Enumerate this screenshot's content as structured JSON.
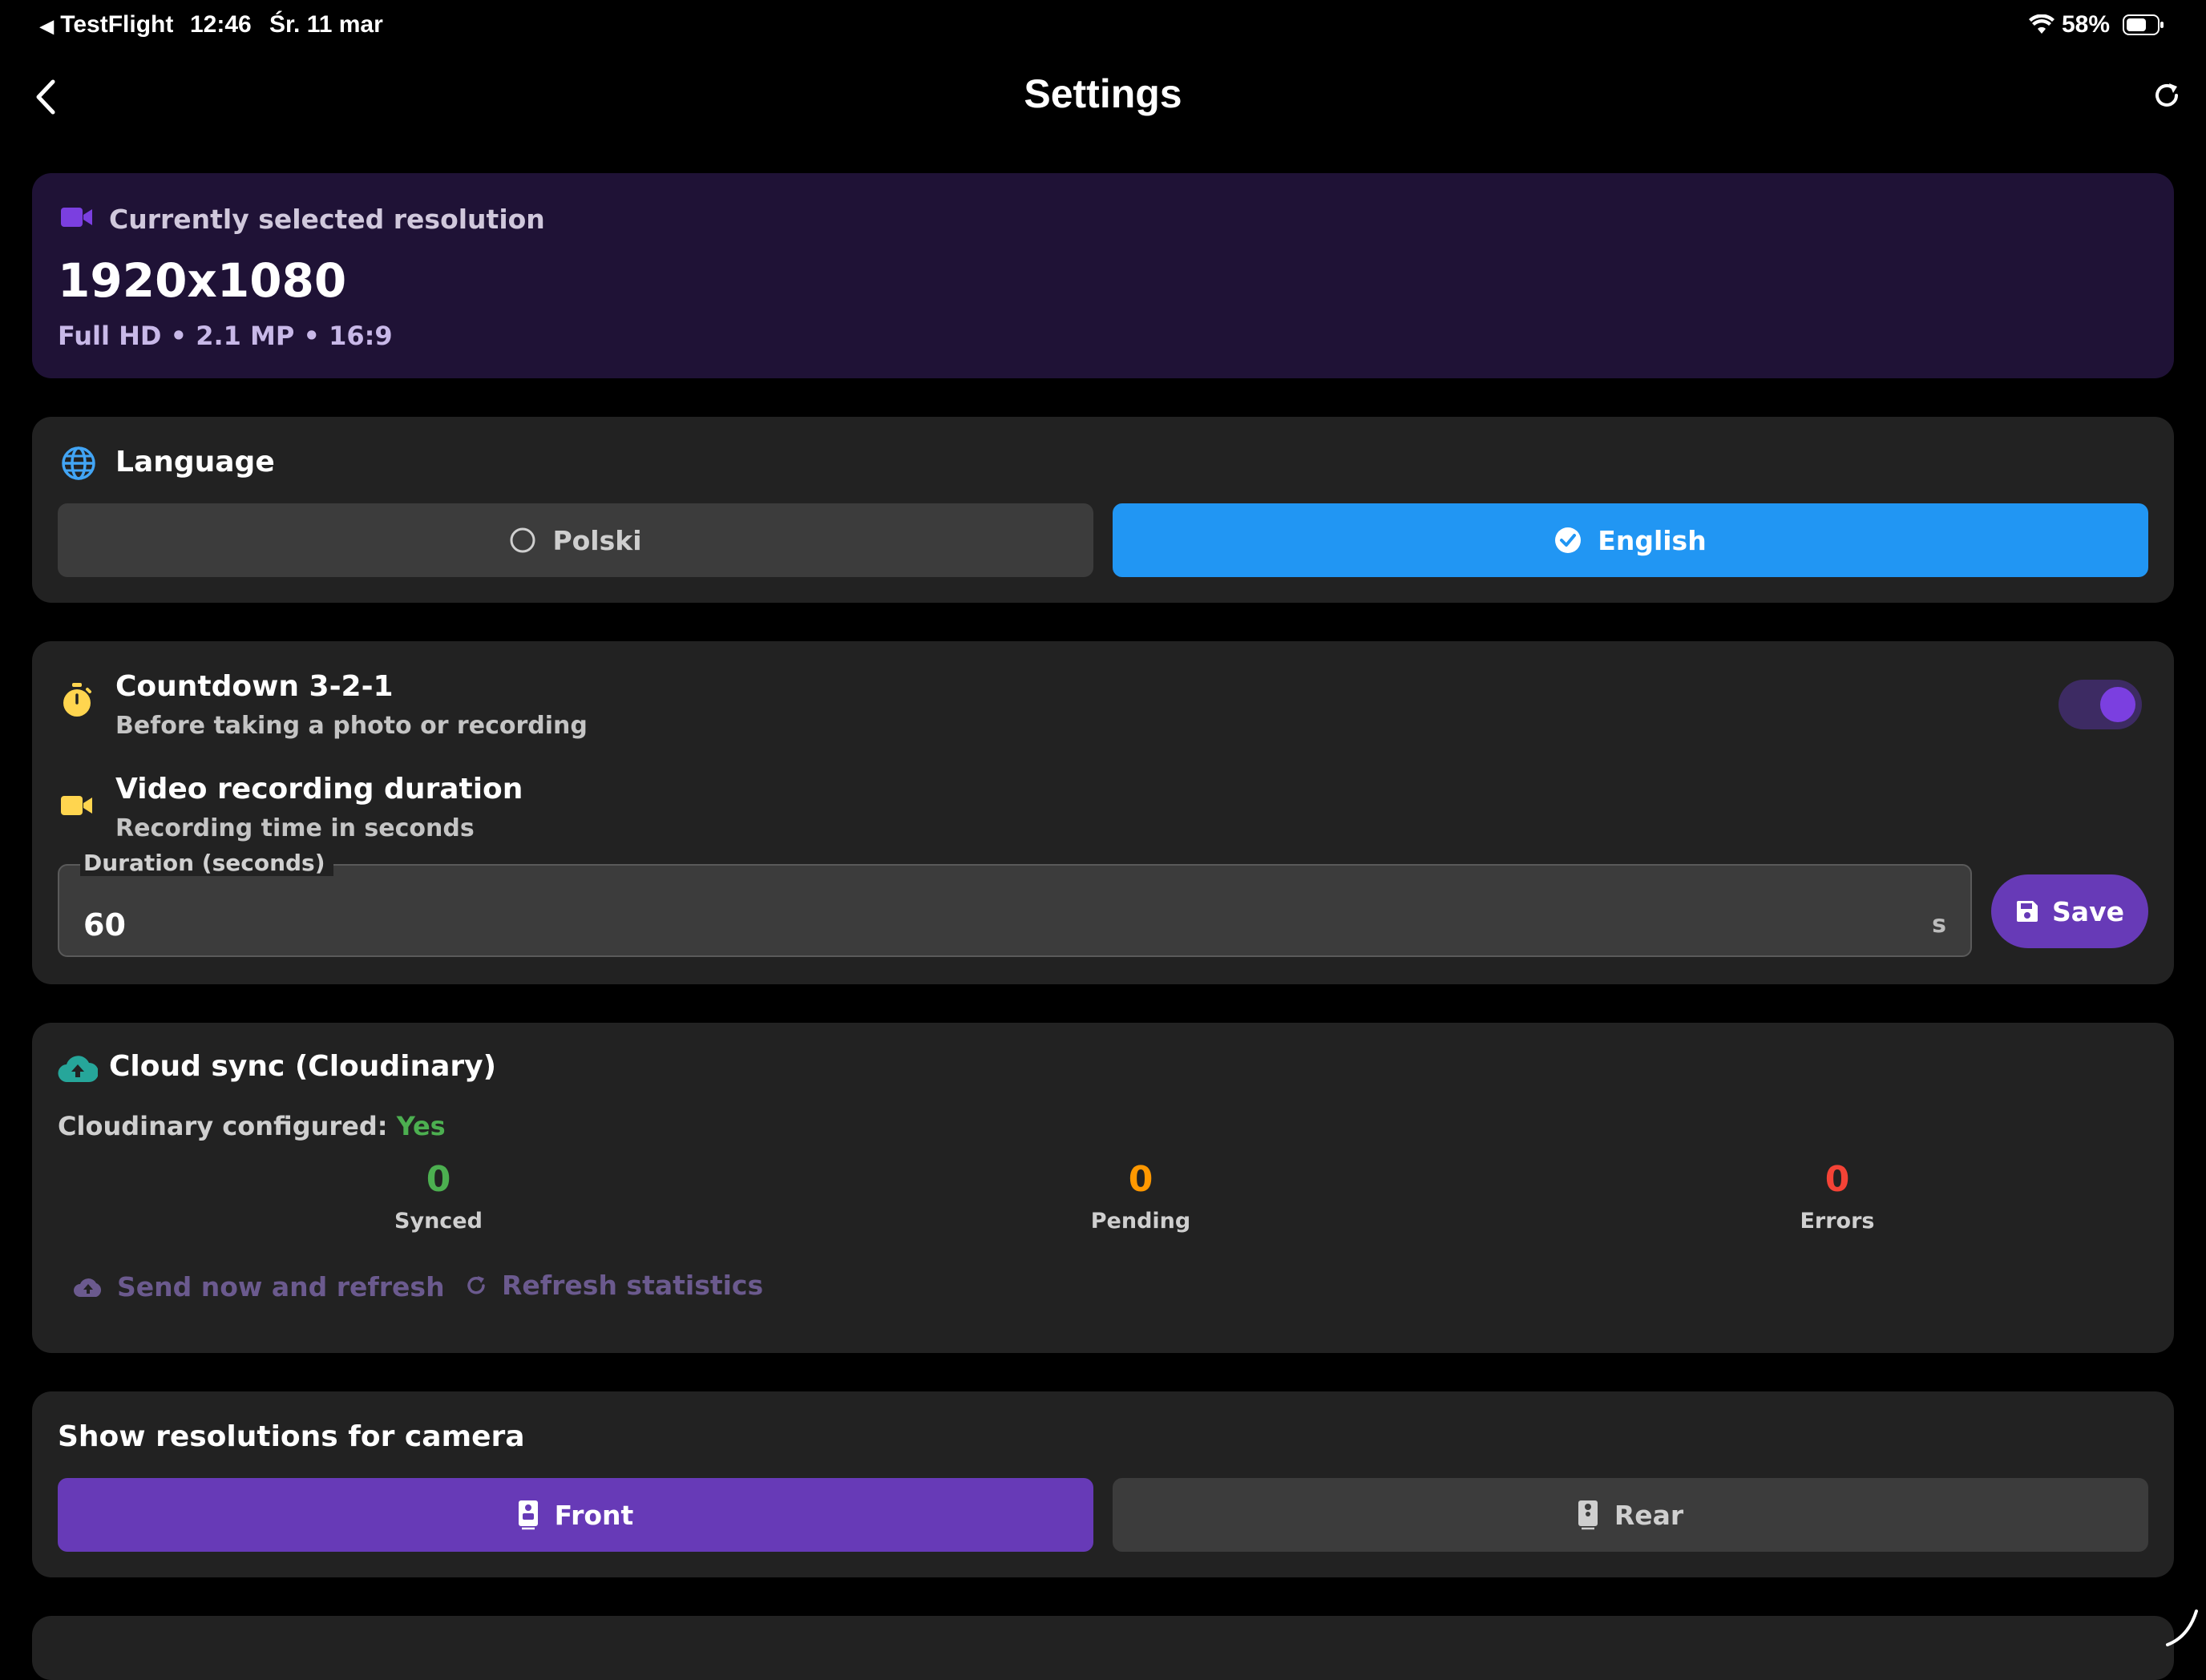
{
  "status_bar": {
    "back_app": "TestFlight",
    "time": "12:46",
    "date": "Śr. 11 mar",
    "battery": "58%"
  },
  "header": {
    "title": "Settings"
  },
  "resolution": {
    "label": "Currently selected resolution",
    "value": "1920x1080",
    "details": "Full HD • 2.1 MP • 16:9"
  },
  "language": {
    "title": "Language",
    "options": [
      "Polski",
      "English"
    ],
    "selected": "English"
  },
  "countdown": {
    "title": "Countdown 3-2-1",
    "subtitle": "Before taking a photo or recording",
    "enabled": true
  },
  "video": {
    "title": "Video recording duration",
    "subtitle": "Recording time in seconds",
    "field_label": "Duration (seconds)",
    "field_value": "60",
    "unit": "s",
    "save_label": "Save"
  },
  "cloud": {
    "title": "Cloud sync (Cloudinary)",
    "configured_label": "Cloudinary configured:",
    "configured_value": "Yes",
    "stats": [
      {
        "value": "0",
        "label": "Synced",
        "color": "#4CAF50"
      },
      {
        "value": "0",
        "label": "Pending",
        "color": "#FF9800"
      },
      {
        "value": "0",
        "label": "Errors",
        "color": "#F44336"
      }
    ],
    "send_label": "Send now and refresh",
    "refresh_label": "Refresh statistics"
  },
  "camera": {
    "title": "Show resolutions for camera",
    "front_label": "Front",
    "rear_label": "Rear",
    "selected": "Front"
  },
  "colors": {
    "accent_purple": "#673AB7",
    "accent_blue": "#2196F3",
    "card_bg": "#222222",
    "resolution_bg": "#1F1236"
  }
}
